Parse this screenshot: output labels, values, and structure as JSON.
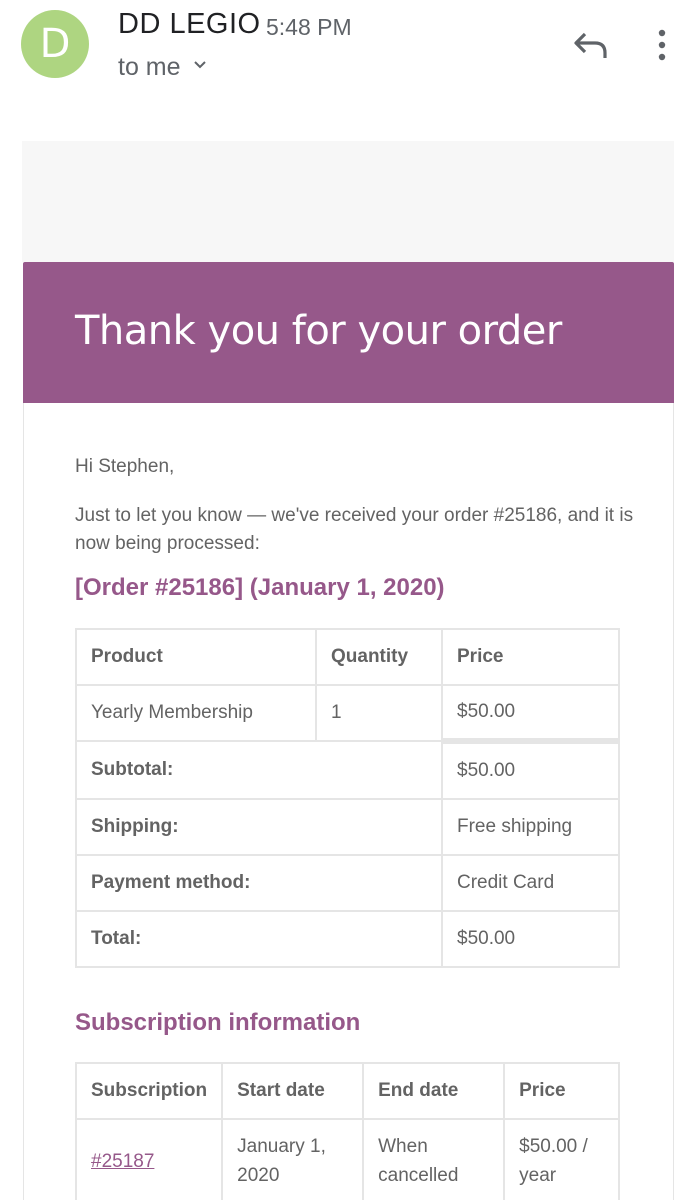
{
  "email": {
    "avatar_letter": "D",
    "sender": "DD LEGIO",
    "time": "5:48 PM",
    "recipient": "to me",
    "icons": {
      "reply": "reply-icon",
      "more": "more-vert-icon",
      "expand": "chevron-down-icon"
    }
  },
  "banner": {
    "title": "Thank you for your order"
  },
  "body": {
    "greeting": "Hi Stephen,",
    "intro": "Just to let you know — we've received your order #25186, and it is now being processed:",
    "order_heading": "[Order #25186] (January 1, 2020)"
  },
  "order_table": {
    "headers": [
      "Product",
      "Quantity",
      "Price"
    ],
    "items": [
      {
        "product": "Yearly Membership",
        "quantity": "1",
        "price": "$50.00"
      }
    ],
    "totals": [
      {
        "label": "Subtotal:",
        "value": "$50.00"
      },
      {
        "label": "Shipping:",
        "value": "Free shipping"
      },
      {
        "label": "Payment method:",
        "value": "Credit Card"
      },
      {
        "label": "Total:",
        "value": "$50.00"
      }
    ]
  },
  "subscription": {
    "heading": "Subscription information",
    "headers": [
      "Subscription",
      "Start date",
      "End date",
      "Price"
    ],
    "rows": [
      {
        "id": "#25187",
        "start_line1": "January 1,",
        "start_line2": "2020",
        "end_line1": "When",
        "end_line2": "cancelled",
        "price_line1": "$50.00 /",
        "price_line2": "year"
      }
    ]
  },
  "colors": {
    "brand": "#96588a",
    "avatar": "#aed581",
    "text": "#636363"
  }
}
